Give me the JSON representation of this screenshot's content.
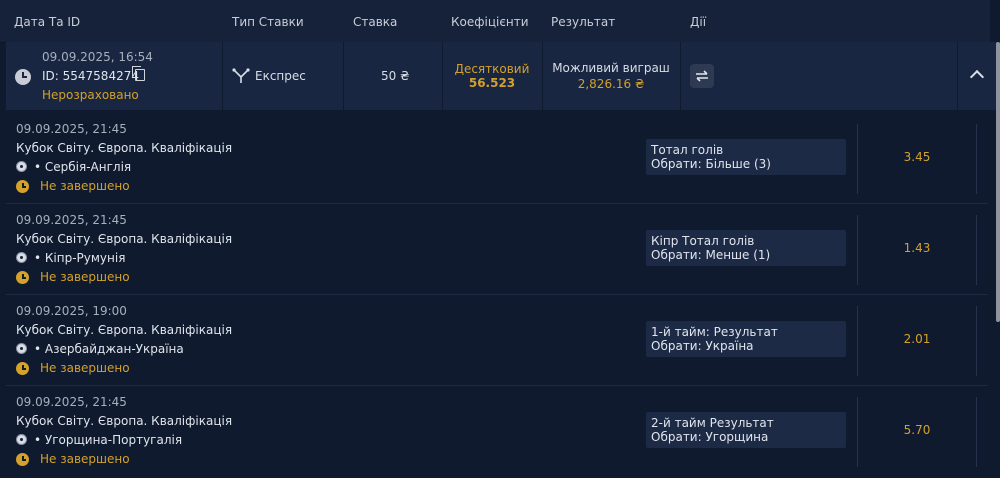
{
  "header": {
    "col_date": "Дата Та ID",
    "col_type": "Тип Ставки",
    "col_stake": "Ставка",
    "col_coef": "Коефіцієнти",
    "col_result": "Результат",
    "col_actions": "Дії"
  },
  "bet": {
    "date": "09.09.2025, 16:54",
    "id": "ID: 5547584274",
    "status": "Нерозраховано",
    "type": "Експрес",
    "stake": "50 ₴",
    "coef_label": "Десятковий",
    "coef_value": "56.523",
    "win_label": "Можливий виграш",
    "win_value": "2,826.16 ₴"
  },
  "events": [
    {
      "date": "09.09.2025, 21:45",
      "league": "Кубок Світу. Європа. Кваліфікація",
      "match": "• Сербія-Англія",
      "status": "Не завершено",
      "market": "Тотал голів",
      "selection": "Обрати: Більше (3)",
      "odd": "3.45"
    },
    {
      "date": "09.09.2025, 21:45",
      "league": "Кубок Світу. Європа. Кваліфікація",
      "match": "• Кіпр-Румунія",
      "status": "Не завершено",
      "market": "Кіпр Тотал голів",
      "selection": "Обрати: Менше (1)",
      "odd": "1.43"
    },
    {
      "date": "09.09.2025, 19:00",
      "league": "Кубок Світу. Європа. Кваліфікація",
      "match": "• Азербайджан-Україна",
      "status": "Не завершено",
      "market": "1-й тайм: Результат",
      "selection": "Обрати: Україна",
      "odd": "2.01"
    },
    {
      "date": "09.09.2025, 21:45",
      "league": "Кубок Світу. Європа. Кваліфікація",
      "match": "• Угорщина-Португалія",
      "status": "Не завершено",
      "market": "2-й тайм Результат",
      "selection": "Обрати: Угорщина",
      "odd": "5.70"
    }
  ],
  "colors": {
    "background": "#0f1a2e",
    "accent": "#d4a12a",
    "row": "#182641"
  }
}
